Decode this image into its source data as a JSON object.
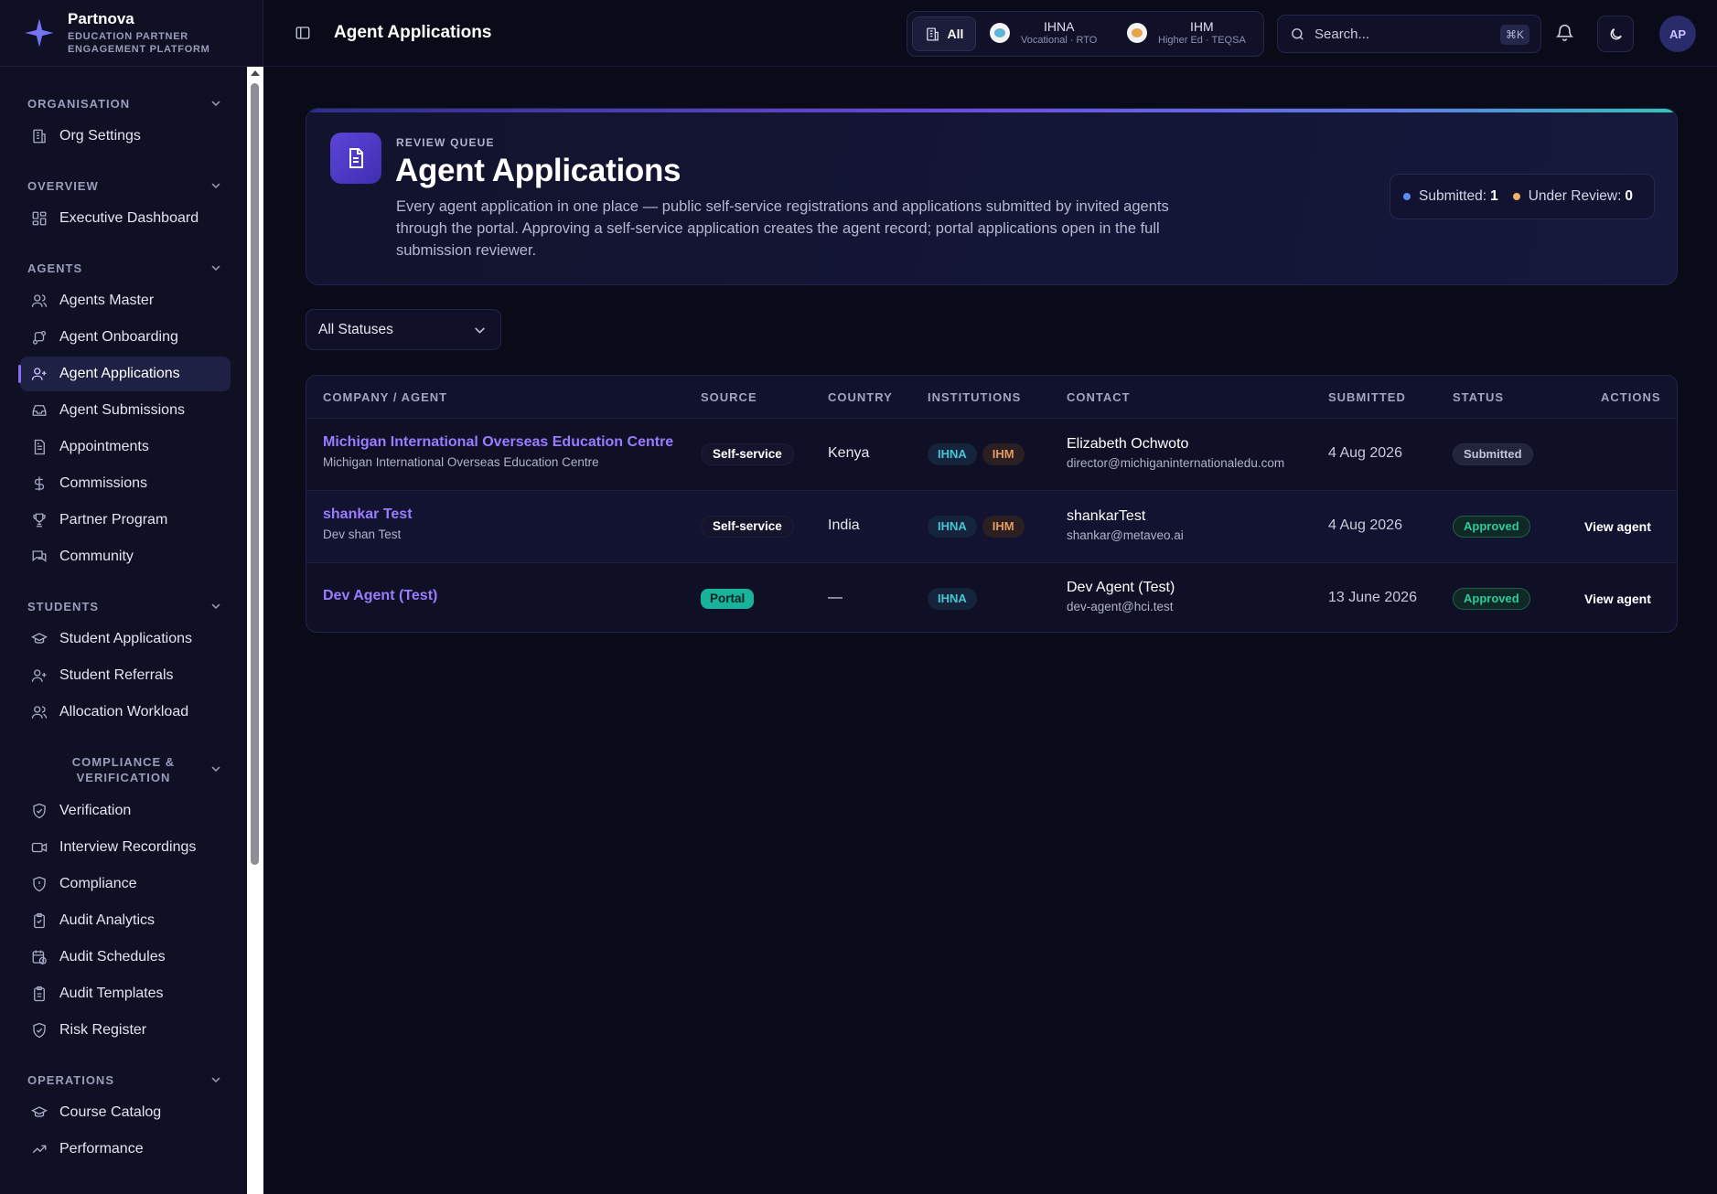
{
  "brand": {
    "name": "Partnova",
    "sub_line1": "EDUCATION PARTNER",
    "sub_line2": "ENGAGEMENT PLATFORM"
  },
  "sidebar": {
    "sections": [
      {
        "title": "ORGANISATION",
        "items": [
          {
            "label": "Org Settings",
            "icon": "building-icon"
          }
        ]
      },
      {
        "title": "OVERVIEW",
        "items": [
          {
            "label": "Executive Dashboard",
            "icon": "grid-icon"
          }
        ]
      },
      {
        "title": "AGENTS",
        "items": [
          {
            "label": "Agents Master",
            "icon": "users-icon"
          },
          {
            "label": "Agent Onboarding",
            "icon": "onboarding-icon"
          },
          {
            "label": "Agent Applications",
            "icon": "user-plus-icon",
            "active": true
          },
          {
            "label": "Agent Submissions",
            "icon": "inbox-icon"
          },
          {
            "label": "Appointments",
            "icon": "file-icon"
          },
          {
            "label": "Commissions",
            "icon": "dollar-icon"
          },
          {
            "label": "Partner Program",
            "icon": "trophy-icon"
          },
          {
            "label": "Community",
            "icon": "chat-icon"
          }
        ]
      },
      {
        "title": "STUDENTS",
        "items": [
          {
            "label": "Student Applications",
            "icon": "graduation-cap-icon"
          },
          {
            "label": "Student Referrals",
            "icon": "user-plus-icon"
          },
          {
            "label": "Allocation Workload",
            "icon": "users-icon"
          }
        ]
      },
      {
        "title_line1": "COMPLIANCE &",
        "title_line2": "VERIFICATION",
        "items": [
          {
            "label": "Verification",
            "icon": "shield-check-icon"
          },
          {
            "label": "Interview Recordings",
            "icon": "video-icon"
          },
          {
            "label": "Compliance",
            "icon": "shield-icon"
          },
          {
            "label": "Audit Analytics",
            "icon": "clipboard-icon"
          },
          {
            "label": "Audit Schedules",
            "icon": "calendar-clock-icon"
          },
          {
            "label": "Audit Templates",
            "icon": "clipboard-icon"
          },
          {
            "label": "Risk Register",
            "icon": "shield-alert-icon"
          }
        ]
      },
      {
        "title": "OPERATIONS",
        "items": [
          {
            "label": "Course Catalog",
            "icon": "graduation-cap-icon"
          },
          {
            "label": "Performance",
            "icon": "trend-icon"
          }
        ]
      }
    ]
  },
  "topbar": {
    "title": "Agent Applications",
    "institutions": {
      "all_label": "All",
      "options": [
        {
          "name": "IHNA",
          "sub": "Vocational · RTO"
        },
        {
          "name": "IHM",
          "sub": "Higher Ed · TEQSA"
        }
      ]
    },
    "search_placeholder": "Search...",
    "search_shortcut": "⌘K",
    "avatar_initials": "AP"
  },
  "hero": {
    "kicker": "REVIEW QUEUE",
    "title": "Agent Applications",
    "description": "Every agent application in one place — public self-service registrations and applications submitted by invited agents through the portal. Approving a self-service application creates the agent record; portal applications open in the full submission reviewer.",
    "stats": [
      {
        "label": "Submitted:",
        "value": "1",
        "color": "#5b8def"
      },
      {
        "label": "Under Review:",
        "value": "0",
        "color": "#f0b36a"
      }
    ]
  },
  "filter": {
    "status_value": "All Statuses"
  },
  "table": {
    "headers": {
      "company": "COMPANY / AGENT",
      "source": "SOURCE",
      "country": "COUNTRY",
      "institutions": "INSTITUTIONS",
      "contact": "CONTACT",
      "submitted": "SUBMITTED",
      "status": "STATUS",
      "actions": "ACTIONS"
    },
    "rows": [
      {
        "company": "Michigan International Overseas Education Centre",
        "agent": "Michigan International Overseas Education Centre",
        "source": "Self-service",
        "country": "Kenya",
        "inst1": "IHNA",
        "inst2": "IHM",
        "contact_name": "Elizabeth Ochwoto",
        "contact_email": "director@michiganinternationaledu.com",
        "submitted": "4 Aug 2026",
        "status": "Submitted",
        "action": ""
      },
      {
        "company": "shankar Test",
        "agent": "Dev shan Test",
        "source": "Self-service",
        "country": "India",
        "inst1": "IHNA",
        "inst2": "IHM",
        "contact_name": "shankarTest",
        "contact_email": "shankar@metaveo.ai",
        "submitted": "4 Aug 2026",
        "status": "Approved",
        "action": "View agent"
      },
      {
        "company": "Dev Agent (Test)",
        "agent": "",
        "source": "Portal",
        "country": "—",
        "inst1": "IHNA",
        "inst2": "",
        "contact_name": "Dev Agent (Test)",
        "contact_email": "dev-agent@hci.test",
        "submitted": "13 June 2026",
        "status": "Approved",
        "action": "View agent"
      }
    ]
  }
}
